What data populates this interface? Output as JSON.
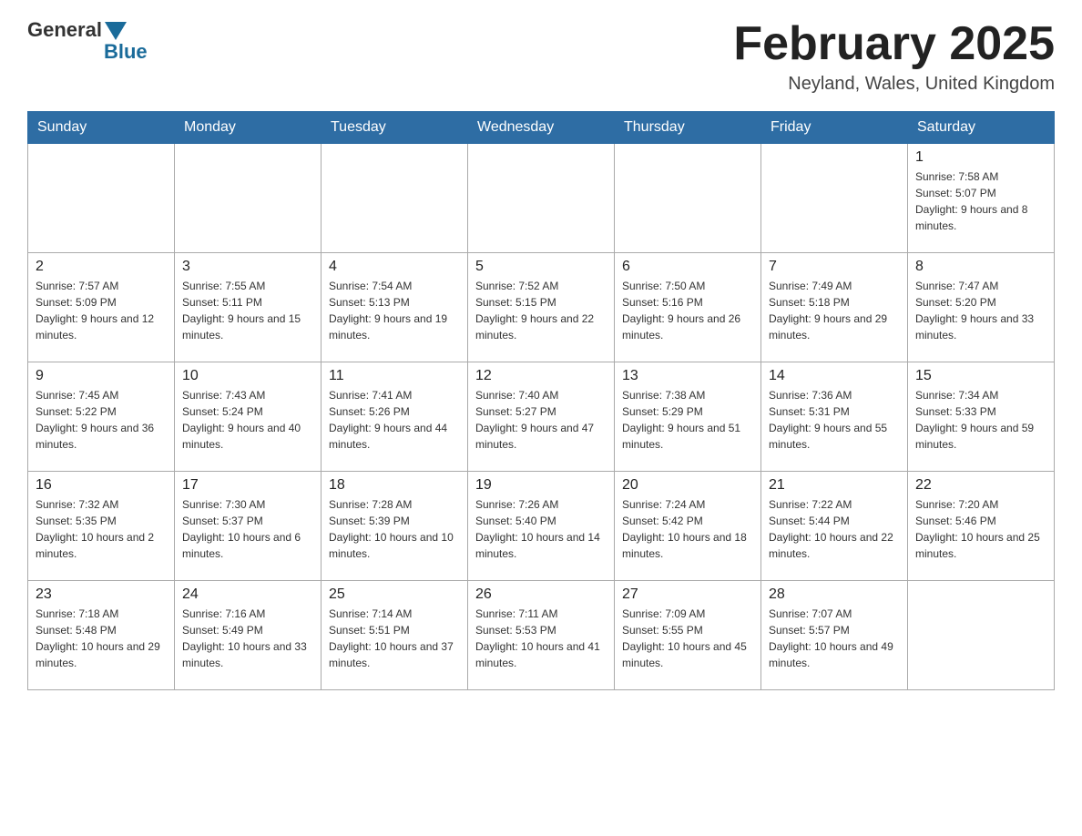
{
  "header": {
    "logo_general": "General",
    "logo_blue": "Blue",
    "month_title": "February 2025",
    "location": "Neyland, Wales, United Kingdom"
  },
  "calendar": {
    "days_of_week": [
      "Sunday",
      "Monday",
      "Tuesday",
      "Wednesday",
      "Thursday",
      "Friday",
      "Saturday"
    ],
    "weeks": [
      [
        {
          "day": "",
          "info": ""
        },
        {
          "day": "",
          "info": ""
        },
        {
          "day": "",
          "info": ""
        },
        {
          "day": "",
          "info": ""
        },
        {
          "day": "",
          "info": ""
        },
        {
          "day": "",
          "info": ""
        },
        {
          "day": "1",
          "info": "Sunrise: 7:58 AM\nSunset: 5:07 PM\nDaylight: 9 hours and 8 minutes."
        }
      ],
      [
        {
          "day": "2",
          "info": "Sunrise: 7:57 AM\nSunset: 5:09 PM\nDaylight: 9 hours and 12 minutes."
        },
        {
          "day": "3",
          "info": "Sunrise: 7:55 AM\nSunset: 5:11 PM\nDaylight: 9 hours and 15 minutes."
        },
        {
          "day": "4",
          "info": "Sunrise: 7:54 AM\nSunset: 5:13 PM\nDaylight: 9 hours and 19 minutes."
        },
        {
          "day": "5",
          "info": "Sunrise: 7:52 AM\nSunset: 5:15 PM\nDaylight: 9 hours and 22 minutes."
        },
        {
          "day": "6",
          "info": "Sunrise: 7:50 AM\nSunset: 5:16 PM\nDaylight: 9 hours and 26 minutes."
        },
        {
          "day": "7",
          "info": "Sunrise: 7:49 AM\nSunset: 5:18 PM\nDaylight: 9 hours and 29 minutes."
        },
        {
          "day": "8",
          "info": "Sunrise: 7:47 AM\nSunset: 5:20 PM\nDaylight: 9 hours and 33 minutes."
        }
      ],
      [
        {
          "day": "9",
          "info": "Sunrise: 7:45 AM\nSunset: 5:22 PM\nDaylight: 9 hours and 36 minutes."
        },
        {
          "day": "10",
          "info": "Sunrise: 7:43 AM\nSunset: 5:24 PM\nDaylight: 9 hours and 40 minutes."
        },
        {
          "day": "11",
          "info": "Sunrise: 7:41 AM\nSunset: 5:26 PM\nDaylight: 9 hours and 44 minutes."
        },
        {
          "day": "12",
          "info": "Sunrise: 7:40 AM\nSunset: 5:27 PM\nDaylight: 9 hours and 47 minutes."
        },
        {
          "day": "13",
          "info": "Sunrise: 7:38 AM\nSunset: 5:29 PM\nDaylight: 9 hours and 51 minutes."
        },
        {
          "day": "14",
          "info": "Sunrise: 7:36 AM\nSunset: 5:31 PM\nDaylight: 9 hours and 55 minutes."
        },
        {
          "day": "15",
          "info": "Sunrise: 7:34 AM\nSunset: 5:33 PM\nDaylight: 9 hours and 59 minutes."
        }
      ],
      [
        {
          "day": "16",
          "info": "Sunrise: 7:32 AM\nSunset: 5:35 PM\nDaylight: 10 hours and 2 minutes."
        },
        {
          "day": "17",
          "info": "Sunrise: 7:30 AM\nSunset: 5:37 PM\nDaylight: 10 hours and 6 minutes."
        },
        {
          "day": "18",
          "info": "Sunrise: 7:28 AM\nSunset: 5:39 PM\nDaylight: 10 hours and 10 minutes."
        },
        {
          "day": "19",
          "info": "Sunrise: 7:26 AM\nSunset: 5:40 PM\nDaylight: 10 hours and 14 minutes."
        },
        {
          "day": "20",
          "info": "Sunrise: 7:24 AM\nSunset: 5:42 PM\nDaylight: 10 hours and 18 minutes."
        },
        {
          "day": "21",
          "info": "Sunrise: 7:22 AM\nSunset: 5:44 PM\nDaylight: 10 hours and 22 minutes."
        },
        {
          "day": "22",
          "info": "Sunrise: 7:20 AM\nSunset: 5:46 PM\nDaylight: 10 hours and 25 minutes."
        }
      ],
      [
        {
          "day": "23",
          "info": "Sunrise: 7:18 AM\nSunset: 5:48 PM\nDaylight: 10 hours and 29 minutes."
        },
        {
          "day": "24",
          "info": "Sunrise: 7:16 AM\nSunset: 5:49 PM\nDaylight: 10 hours and 33 minutes."
        },
        {
          "day": "25",
          "info": "Sunrise: 7:14 AM\nSunset: 5:51 PM\nDaylight: 10 hours and 37 minutes."
        },
        {
          "day": "26",
          "info": "Sunrise: 7:11 AM\nSunset: 5:53 PM\nDaylight: 10 hours and 41 minutes."
        },
        {
          "day": "27",
          "info": "Sunrise: 7:09 AM\nSunset: 5:55 PM\nDaylight: 10 hours and 45 minutes."
        },
        {
          "day": "28",
          "info": "Sunrise: 7:07 AM\nSunset: 5:57 PM\nDaylight: 10 hours and 49 minutes."
        },
        {
          "day": "",
          "info": ""
        }
      ]
    ]
  }
}
